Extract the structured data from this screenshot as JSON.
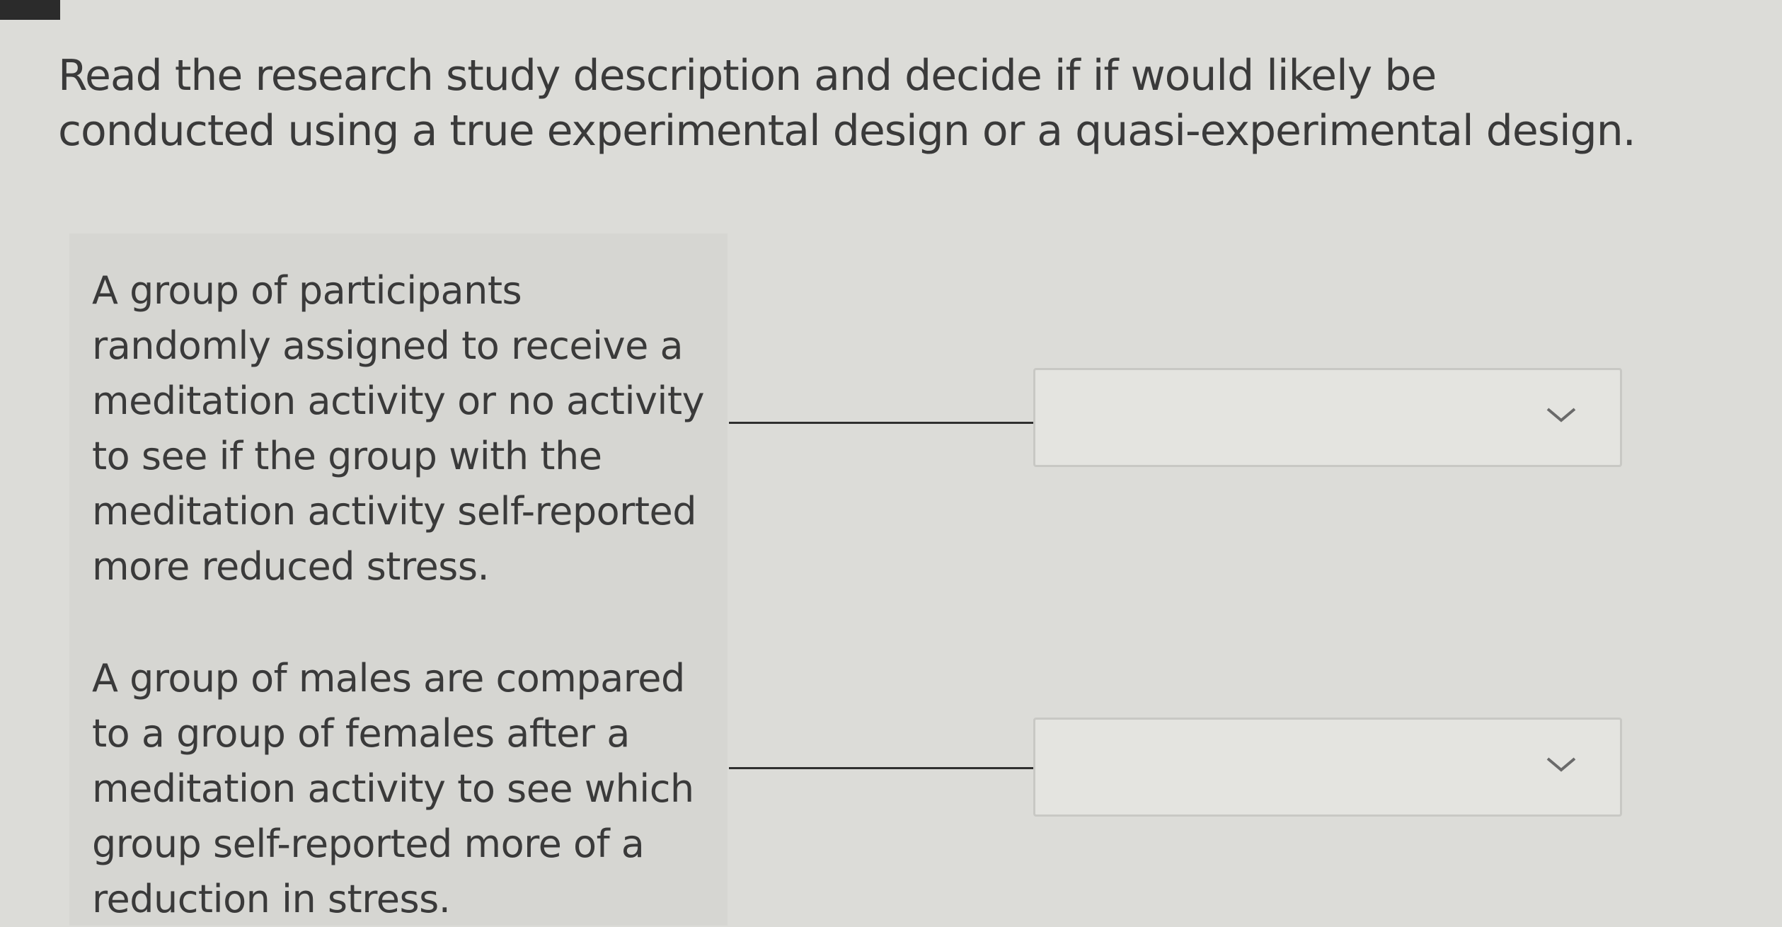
{
  "question": {
    "prompt": "Read the research study description and decide if if would likely be conducted using a true experimental design or a quasi-experimental design."
  },
  "items": [
    {
      "description": "A group of participants randomly assigned to receive a meditation activity or no activity to see if the group with the meditation activity self-reported more reduced stress.",
      "selected": ""
    },
    {
      "description": "A group of males are compared to a group of females after a meditation activity to see which group self-reported more of a reduction in stress.",
      "selected": ""
    }
  ],
  "icons": {
    "dropdown": "chevron-down-icon"
  }
}
